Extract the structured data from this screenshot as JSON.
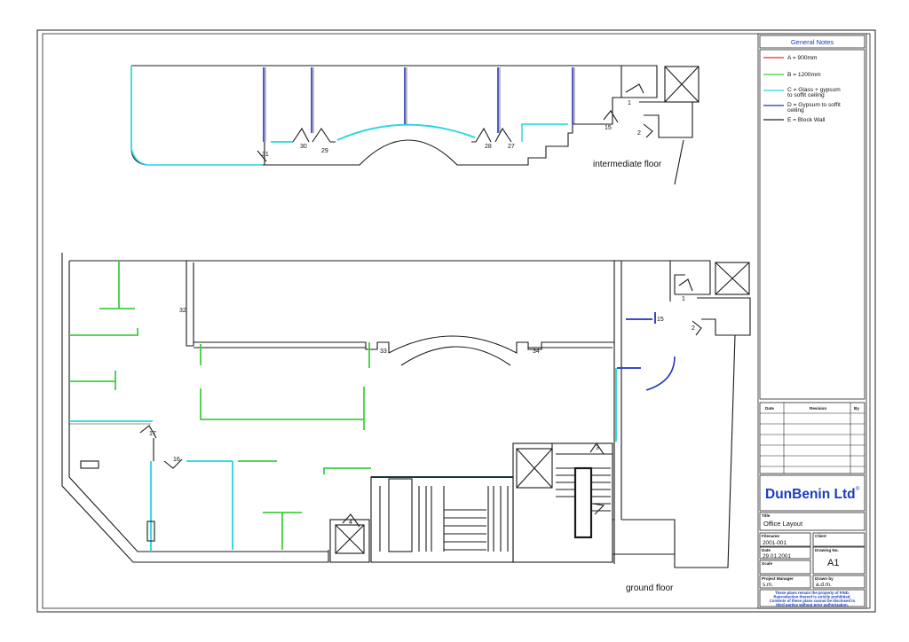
{
  "legend": {
    "title": "General Notes",
    "items": [
      {
        "label": "A = 900mm",
        "color": "#e03030"
      },
      {
        "label": "B = 1200mm",
        "color": "#3fcf3f"
      },
      {
        "label": "C = Glass + gypsum",
        "label2": "to soffit ceiling",
        "color": "#22d6e0"
      },
      {
        "label": "D = Gypsum to soffit",
        "label2": "ceiling",
        "color": "#2233bb"
      },
      {
        "label": "E = Block Wall",
        "color": "#222222"
      }
    ]
  },
  "revision_table": {
    "headers": [
      "Date",
      "Revision",
      "By"
    ]
  },
  "company": {
    "name": "DunBenin Ltd",
    "mark": "®",
    "color": "#1a3dbf"
  },
  "title_block": {
    "title_label": "Title",
    "title": "Office Layout",
    "filename_label": "Filename",
    "filename": "2001-001",
    "client_label": "Client",
    "client": "",
    "date_label": "Date",
    "date": "29.01.2001",
    "drawing_no_label": "Drawing No.",
    "drawing_no": "A1",
    "scale_label": "Scale",
    "scale": "",
    "pm_label": "Project Manager",
    "pm": "s.m.",
    "drawn_label": "Drawn by",
    "drawn": "a.d.m.",
    "disclaimer": [
      "These plans remain the property of FIND.",
      "Reproduction thereof is strictly prohibited.",
      "Contents of these plans cannot be disclosed to",
      "third parties without prior authorization."
    ]
  },
  "plans": {
    "intermediate": {
      "caption": "intermediate floor",
      "door_labels": [
        "31",
        "30",
        "29",
        "28",
        "27",
        "15",
        "1",
        "2"
      ]
    },
    "ground": {
      "caption": "ground floor",
      "door_labels": [
        "32",
        "33",
        "34",
        "1",
        "15",
        "2",
        "3",
        "17",
        "16",
        "4"
      ]
    }
  }
}
